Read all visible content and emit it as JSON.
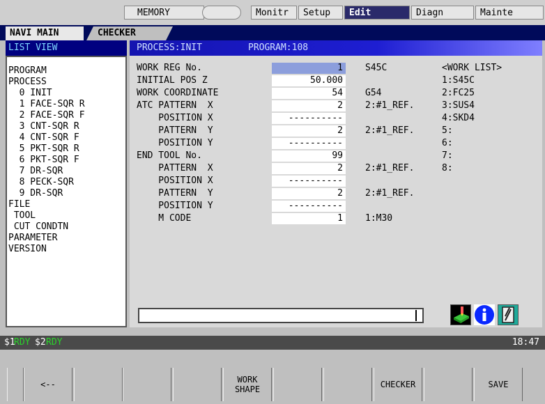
{
  "top_tabs": {
    "memory": "MEMORY",
    "monitr": "Monitr",
    "setup": "Setup",
    "edit": "Edit",
    "diagn": "Diagn",
    "mainte": "Mainte"
  },
  "sub_tabs": {
    "navi_main": "NAVI MAIN",
    "checker": "CHECKER"
  },
  "list": {
    "header": "LIST VIEW",
    "items": [
      "PROGRAM",
      "PROCESS",
      "  0 INIT",
      "  1 FACE-SQR R",
      "  2 FACE-SQR F",
      "  3 CNT-SQR R",
      "  4 CNT-SQR F",
      "  5 PKT-SQR R",
      "  6 PKT-SQR F",
      "  7 DR-SQR",
      "  8 PECK-SQR",
      "  9 DR-SQR",
      "FILE",
      " TOOL",
      " CUT CONDTN",
      "PARAMETER",
      "VERSION"
    ]
  },
  "main": {
    "process": "PROCESS:INIT",
    "program": "PROGRAM:108",
    "rows": [
      {
        "label": "WORK REG No.",
        "value": "1",
        "note": "S45C"
      },
      {
        "label": "INITIAL POS Z",
        "value": "50.000",
        "note": ""
      },
      {
        "label": "WORK COORDINATE",
        "value": "54",
        "note": "G54"
      },
      {
        "label": "ATC PATTERN  X",
        "value": "2",
        "note": "2:#1_REF."
      },
      {
        "label": "    POSITION X",
        "value": "----------",
        "note": ""
      },
      {
        "label": "    PATTERN  Y",
        "value": "2",
        "note": "2:#1_REF."
      },
      {
        "label": "    POSITION Y",
        "value": "----------",
        "note": ""
      },
      {
        "label": "END TOOL No.",
        "value": "99",
        "note": ""
      },
      {
        "label": "    PATTERN  X",
        "value": "2",
        "note": "2:#1_REF."
      },
      {
        "label": "    POSITION X",
        "value": "----------",
        "note": ""
      },
      {
        "label": "    PATTERN  Y",
        "value": "2",
        "note": "2:#1_REF."
      },
      {
        "label": "    POSITION Y",
        "value": "----------",
        "note": ""
      },
      {
        "label": "    M CODE",
        "value": "1",
        "note": "1:M30"
      }
    ],
    "work_list": [
      "<WORK LIST>",
      "1:S45C",
      "2:FC25",
      "3:SUS4",
      "4:SKD4",
      "5:",
      "6:",
      "7:",
      "8:"
    ]
  },
  "status": {
    "ch1": "$1",
    "rdy1": "RDY",
    "ch2": "$2",
    "rdy2": "RDY",
    "time": "18:47"
  },
  "softkeys": [
    "<--",
    "",
    "",
    "",
    "WORK\nSHAPE",
    "",
    "",
    "CHECKER",
    "",
    "SAVE"
  ],
  "icons": [
    "workpiece-3d-icon",
    "info-icon",
    "tool-icon"
  ]
}
